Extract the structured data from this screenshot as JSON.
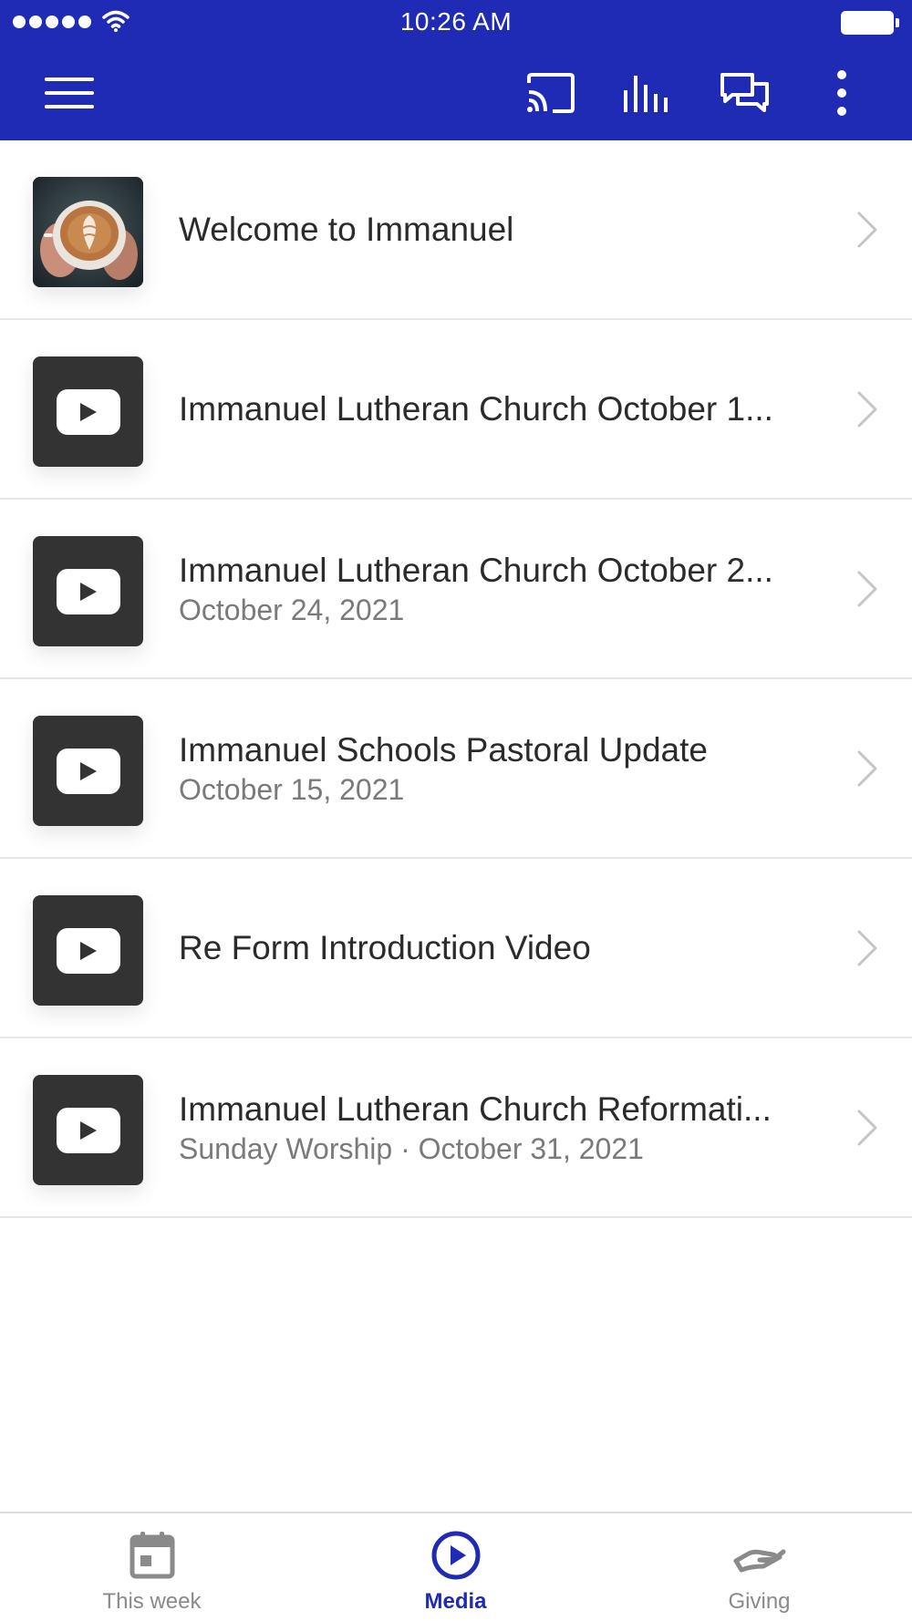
{
  "status_bar": {
    "time": "10:26 AM"
  },
  "header": {
    "icons": [
      "menu-icon",
      "cast-icon",
      "stats-icon",
      "chat-icon",
      "more-icon"
    ],
    "background_color": "#1f2bb5"
  },
  "media_list": [
    {
      "title": "Welcome to Immanuel",
      "subtitle": "",
      "thumbnail": "latte-photo"
    },
    {
      "title": "Immanuel Lutheran Church October 1...",
      "subtitle": "",
      "thumbnail": "youtube-icon"
    },
    {
      "title": "Immanuel Lutheran Church October 2...",
      "subtitle": "October 24, 2021",
      "thumbnail": "youtube-icon"
    },
    {
      "title": "Immanuel Schools Pastoral Update",
      "subtitle": "October 15, 2021",
      "thumbnail": "youtube-icon"
    },
    {
      "title": "Re Form Introduction Video",
      "subtitle": "",
      "thumbnail": "youtube-icon"
    },
    {
      "title": "Immanuel Lutheran Church Reformati...",
      "subtitle": "Sunday Worship · October 31, 2021",
      "thumbnail": "youtube-icon"
    }
  ],
  "tab_bar": {
    "tabs": [
      {
        "label": "This week",
        "icon": "calendar-icon",
        "active": false
      },
      {
        "label": "Media",
        "icon": "play-circle-icon",
        "active": true
      },
      {
        "label": "Giving",
        "icon": "giving-hand-icon",
        "active": false
      }
    ],
    "active_color": "#1f2bb5"
  }
}
